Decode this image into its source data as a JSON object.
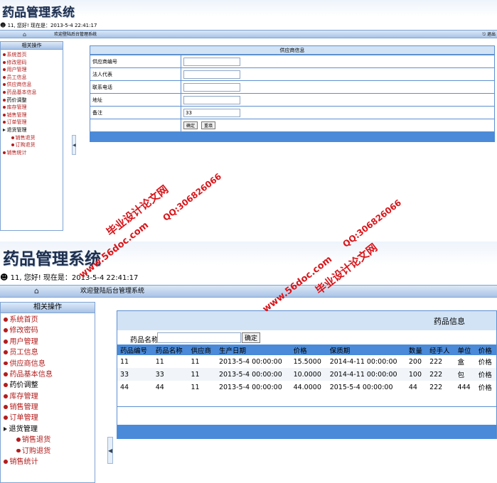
{
  "top": {
    "app_title": "药品管理系统",
    "user_greeting": "11, 您好! 现在是：2013-5-4 22:41:17",
    "welcome": "欢迎登陆后台管理系统",
    "exit_label": "退出",
    "sidebar_title": "相关操作",
    "menu": [
      "系统首页",
      "修改密码",
      "用户管理",
      "员工信息",
      "供应商信息",
      "药品基本信息",
      "药价调整",
      "库存管理",
      "销售管理",
      "订单管理",
      "退货管理",
      "销售退货",
      "订购退货",
      "销售统计"
    ],
    "form": {
      "header": "供应商信息",
      "fields": [
        {
          "label": "供应商编号",
          "value": ""
        },
        {
          "label": "法人代表",
          "value": ""
        },
        {
          "label": "联系电话",
          "value": ""
        },
        {
          "label": "地址",
          "value": ""
        },
        {
          "label": "备注",
          "value": "33"
        }
      ],
      "confirm_label": "确定",
      "reset_label": "重填"
    }
  },
  "bottom": {
    "app_title": "药品管理系统",
    "user_greeting": "11, 您好! 现在是：2013-5-4 22:41:17",
    "welcome": "欢迎登陆后台管理系统",
    "sidebar_title": "相关操作",
    "menu": [
      "系统首页",
      "修改密码",
      "用户管理",
      "员工信息",
      "供应商信息",
      "药品基本信息",
      "药价调整",
      "库存管理",
      "销售管理",
      "订单管理",
      "退货管理",
      "销售退货",
      "订购退货",
      "销售统计"
    ],
    "drug_panel": {
      "header": "药品信息",
      "search_label": "药品名称",
      "search_value": "",
      "search_button": "确定",
      "columns": [
        "药品编号",
        "药品名称",
        "供应商",
        "生产日期",
        "价格",
        "保质期",
        "数量",
        "经手人",
        "单位",
        "价格"
      ],
      "rows": [
        [
          "11",
          "11",
          "11",
          "2013-5-4 00:00:00",
          "15.5000",
          "2014-4-11 00:00:00",
          "200",
          "222",
          "盒",
          "价格"
        ],
        [
          "33",
          "33",
          "11",
          "2013-5-4 00:00:00",
          "10.0000",
          "2014-4-11 00:00:00",
          "100",
          "222",
          "包",
          "价格"
        ],
        [
          "44",
          "44",
          "11",
          "2013-5-4 00:00:00",
          "44.0000",
          "2015-5-4 00:00:00",
          "44",
          "222",
          "444",
          "价格"
        ]
      ]
    }
  },
  "watermarks": [
    "毕业设计论文网",
    "www.56doc.com",
    "QQ:306826066"
  ],
  "colors": {
    "accent": "#4a8ad8",
    "menu_red": "#b31d1d",
    "watermark_red": "#d8161b",
    "border": "#5c8fd0"
  },
  "icons": [
    "user-icon",
    "home-icon",
    "arrow-left-icon",
    "bullet-dot-icon"
  ]
}
